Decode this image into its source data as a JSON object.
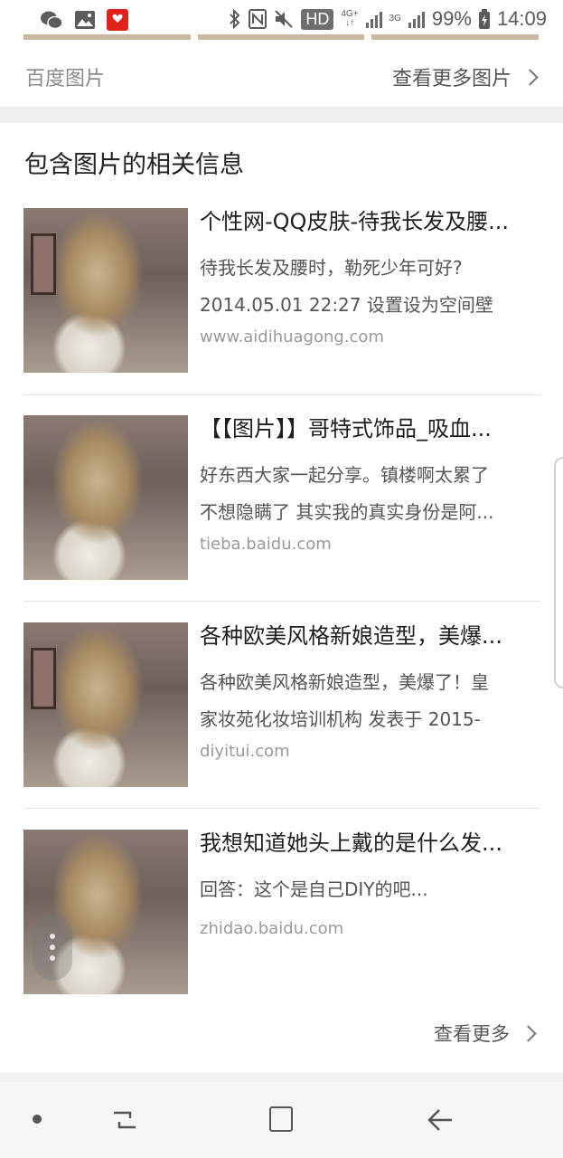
{
  "status_bar": {
    "hd": "HD",
    "network_4g": "4G+",
    "network_3g": "3G",
    "battery": "99%",
    "time": "14:09",
    "icons": [
      "wechat-icon",
      "gallery-icon",
      "app-icon",
      "bluetooth-icon",
      "nfc-icon",
      "mute-icon",
      "signal-icon",
      "battery-icon"
    ]
  },
  "image_source": {
    "label": "百度图片",
    "more_label": "查看更多图片"
  },
  "related": {
    "title": "包含图片的相关信息",
    "results": [
      {
        "title": "个性网-QQ皮肤-待我长发及腰...",
        "desc_line1": "待我长发及腰时，勒死少年可好?",
        "desc_line2": "2014.05.01 22:27 设置设为空间壁",
        "url": "www.aidihuagong.com"
      },
      {
        "title": "【【图片】】哥特式饰品_吸血...",
        "desc_line1": "好东西大家一起分享。镇楼啊太累了",
        "desc_line2": "不想隐瞒了 其实我的真实身份是阿...",
        "url": "tieba.baidu.com"
      },
      {
        "title": "各种欧美风格新娘造型，美爆...",
        "desc_line1": "各种欧美风格新娘造型，美爆了！皇",
        "desc_line2": "家妆苑化妆培训机构 发表于 2015-",
        "url": "diyitui.com"
      },
      {
        "title": "我想知道她头上戴的是什么发...",
        "desc_line1": "回答：这个是自己DIY的吧...",
        "desc_line2": "",
        "url": "zhidao.baidu.com"
      }
    ],
    "see_more": "查看更多"
  },
  "nav": {
    "icons": [
      "menu-dot-icon",
      "recent-apps-icon",
      "home-icon",
      "back-icon"
    ]
  }
}
